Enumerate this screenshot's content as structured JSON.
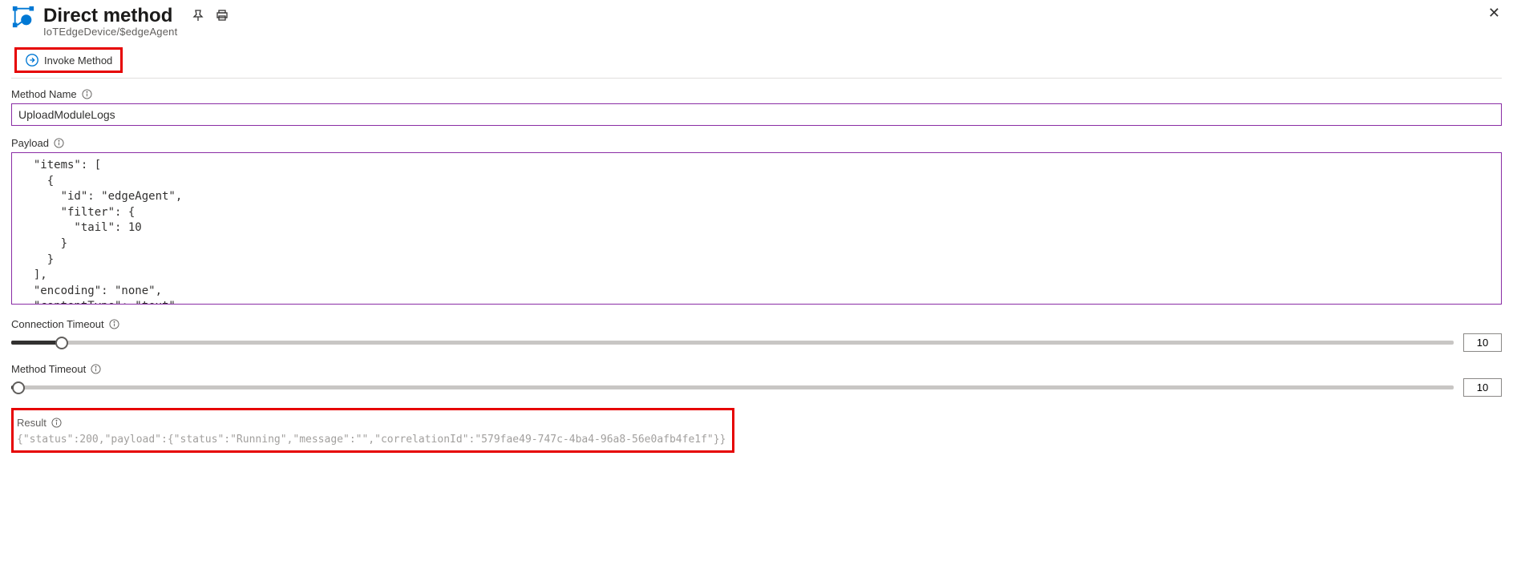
{
  "header": {
    "title": "Direct method",
    "subtitle": "IoTEdgeDevice/$edgeAgent"
  },
  "toolbar": {
    "invoke_label": "Invoke Method"
  },
  "fields": {
    "method_name_label": "Method Name",
    "method_name_value": "UploadModuleLogs",
    "payload_label": "Payload",
    "payload_value": "  \"items\": [\n    {\n      \"id\": \"edgeAgent\",\n      \"filter\": {\n        \"tail\": 10\n      }\n    }\n  ],\n  \"encoding\": \"none\",\n  \"contentType\": \"text\"",
    "conn_timeout_label": "Connection Timeout",
    "conn_timeout_value": "10",
    "method_timeout_label": "Method Timeout",
    "method_timeout_value": "10"
  },
  "result": {
    "label": "Result",
    "text": "{\"status\":200,\"payload\":{\"status\":\"Running\",\"message\":\"\",\"correlationId\":\"579fae49-747c-4ba4-96a8-56e0afb4fe1f\"}}"
  }
}
